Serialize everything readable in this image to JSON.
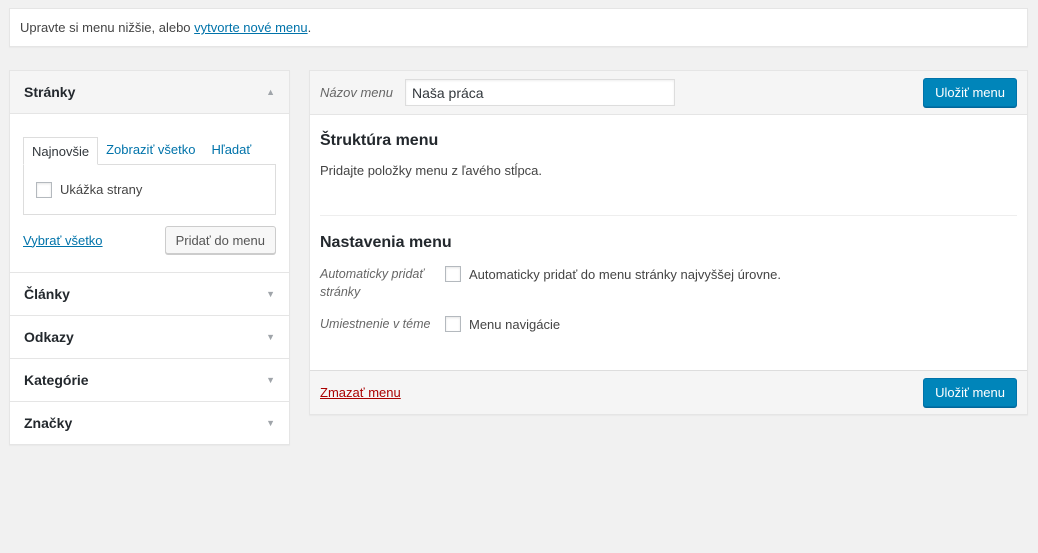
{
  "notice": {
    "text": "Upravte si menu nižšie, alebo",
    "link": "vytvorte nové menu",
    "suffix": "."
  },
  "accordion": {
    "pages": {
      "title": "Stránky",
      "tabs": [
        "Najnovšie",
        "Zobraziť všetko",
        "Hľadať"
      ],
      "items": [
        "Ukážka strany"
      ],
      "select_all": "Vybrať všetko",
      "add_button": "Pridať do menu"
    },
    "sections": [
      "Články",
      "Odkazy",
      "Kategórie",
      "Značky"
    ]
  },
  "menu": {
    "name_label": "Názov menu",
    "name_value": "Naša práca",
    "save_label": "Uložiť menu",
    "structure_title": "Štruktúra menu",
    "structure_desc": "Pridajte položky menu z ľavého stĺpca.",
    "settings_title": "Nastavenia menu",
    "auto_add_label": "Automaticky pridať stránky",
    "auto_add_option": "Automaticky pridať do menu stránky najvyššej úrovne.",
    "location_label": "Umiestnenie v téme",
    "location_option": "Menu navigácie",
    "delete_label": "Zmazať menu"
  },
  "colors": {
    "primary_button": "#0085ba",
    "link": "#0073aa",
    "delete_link": "#aa0000",
    "background": "#f1f1f1"
  }
}
